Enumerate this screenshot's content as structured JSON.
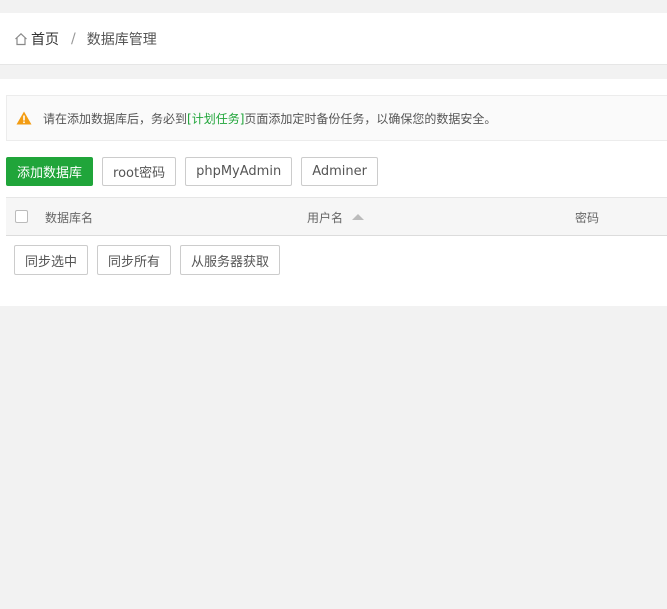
{
  "breadcrumb": {
    "home_label": "首页",
    "separator": "/",
    "current": "数据库管理"
  },
  "notice": {
    "text_before": "请在添加数据库后，务必到",
    "link_text": "[计划任务]",
    "text_after": "页面添加定时备份任务，以确保您的数据安全。",
    "icon": "warning-icon",
    "icon_color": "#f39c12"
  },
  "toolbar": {
    "add_db": "添加数据库",
    "root_password": "root密码",
    "phpmyadmin": "phpMyAdmin",
    "adminer": "Adminer"
  },
  "table": {
    "columns": {
      "name": "数据库名",
      "user": "用户名",
      "password": "密码"
    },
    "rows": []
  },
  "sync": {
    "sync_selected": "同步选中",
    "sync_all": "同步所有",
    "fetch_from_server": "从服务器获取"
  },
  "colors": {
    "primary": "#20a53a",
    "link": "#20a53a"
  }
}
